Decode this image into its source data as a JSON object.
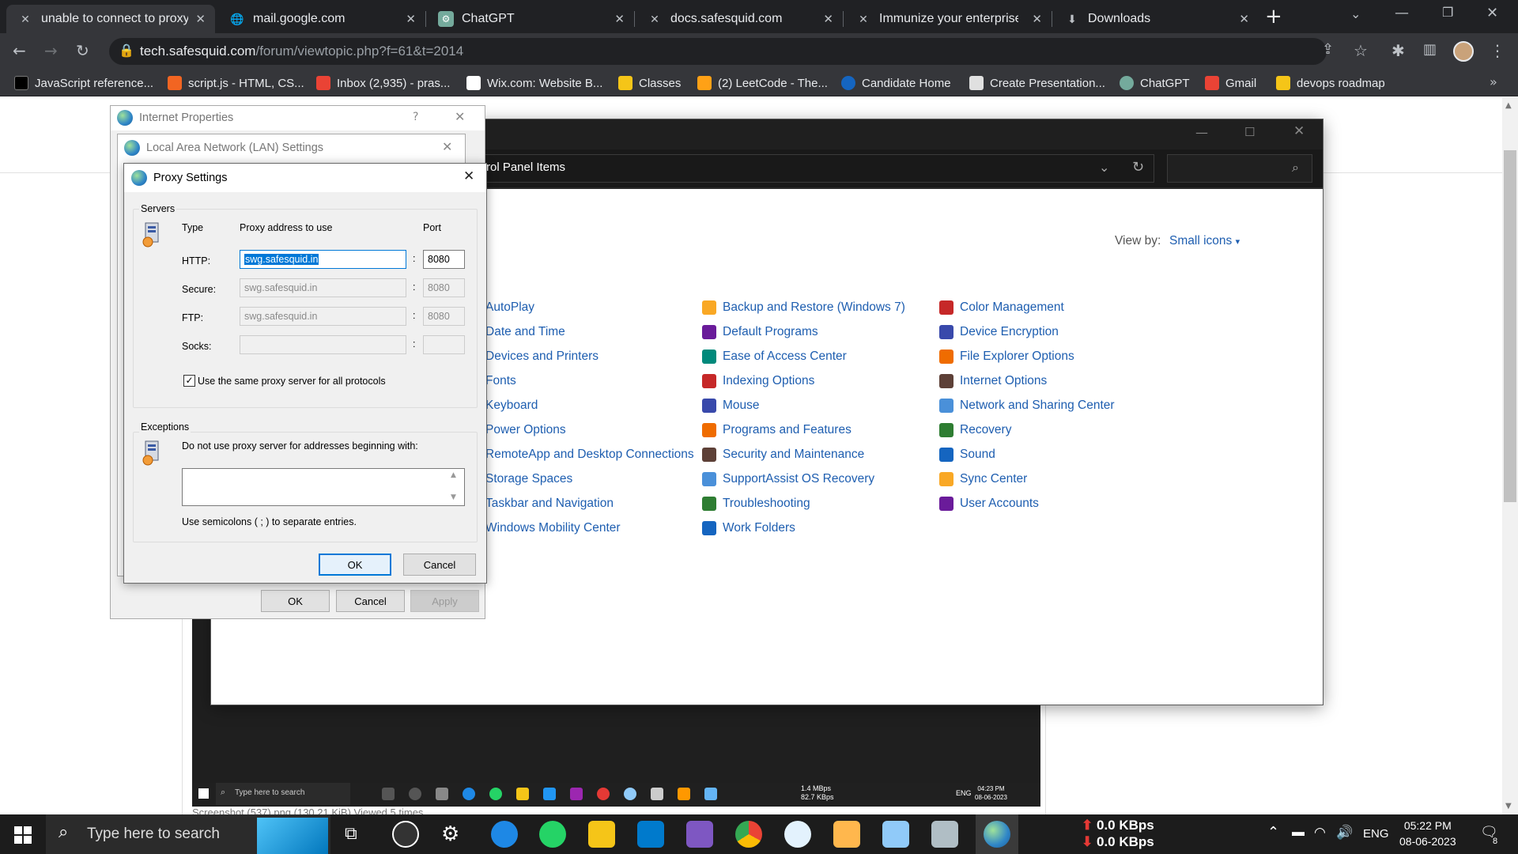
{
  "browser": {
    "tabs": [
      {
        "title": "unable to connect to proxy",
        "icon": "tools-icon"
      },
      {
        "title": "mail.google.com",
        "icon": "globe-icon"
      },
      {
        "title": "ChatGPT",
        "icon": "chatgpt-icon"
      },
      {
        "title": "docs.safesquid.com",
        "icon": "tools-icon"
      },
      {
        "title": "Immunize your enterprise",
        "icon": "tools-icon"
      },
      {
        "title": "Downloads",
        "icon": "download-icon"
      }
    ],
    "url_host": "tech.safesquid.com",
    "url_path": "/forum/viewtopic.php?f=61&t=2014",
    "bookmarks": [
      {
        "label": "JavaScript reference...",
        "color": "#000000"
      },
      {
        "label": "script.js - HTML, CS...",
        "color": "#f26522"
      },
      {
        "label": "Inbox (2,935) - pras...",
        "color": "#ea4335"
      },
      {
        "label": "Wix.com: Website B...",
        "color": "#ffffff"
      },
      {
        "label": "Classes",
        "color": "#f5c518"
      },
      {
        "label": "(2) LeetCode - The...",
        "color": "#ffa116"
      },
      {
        "label": "Candidate Home",
        "color": "#1565c0"
      },
      {
        "label": "Create Presentation...",
        "color": "#e0e0e0"
      },
      {
        "label": "ChatGPT",
        "color": "#74aa9c"
      },
      {
        "label": "Gmail",
        "color": "#ea4335"
      },
      {
        "label": "devops roadmap",
        "color": "#f5c518"
      }
    ]
  },
  "control_panel": {
    "address": "rol Panel Items",
    "view_by_label": "View by:",
    "view_by_value": "Small icons",
    "items_col1": [
      "AutoPlay",
      "Date and Time",
      "Devices and Printers",
      "Fonts",
      "Keyboard",
      "Power Options",
      "RemoteApp and Desktop Connections",
      "Storage Spaces",
      "Taskbar and Navigation",
      "Windows Mobility Center"
    ],
    "items_col2": [
      "Backup and Restore (Windows 7)",
      "Default Programs",
      "Ease of Access Center",
      "Indexing Options",
      "Mouse",
      "Programs and Features",
      "Security and Maintenance",
      "SupportAssist OS Recovery",
      "Troubleshooting",
      "Work Folders"
    ],
    "items_col3": [
      "Color Management",
      "Device Encryption",
      "File Explorer Options",
      "Internet Options",
      "Network and Sharing Center",
      "Recovery",
      "Sound",
      "Sync Center",
      "User Accounts"
    ]
  },
  "internet_properties": {
    "title": "Internet Properties",
    "help": "?",
    "ok": "OK",
    "cancel": "Cancel",
    "apply": "Apply"
  },
  "lan_settings": {
    "title": "Local Area Network (LAN) Settings"
  },
  "proxy_settings": {
    "title": "Proxy Settings",
    "servers_label": "Servers",
    "col_type": "Type",
    "col_address": "Proxy address to use",
    "col_port": "Port",
    "rows": [
      {
        "type": "HTTP:",
        "address": "swg.safesquid.in",
        "port": "8080"
      },
      {
        "type": "Secure:",
        "address": "swg.safesquid.in",
        "port": "8080"
      },
      {
        "type": "FTP:",
        "address": "swg.safesquid.in",
        "port": "8080"
      },
      {
        "type": "Socks:",
        "address": "",
        "port": ""
      }
    ],
    "colon": ":",
    "same_proxy_label": "Use the same proxy server for all protocols",
    "exceptions_label": "Exceptions",
    "exceptions_desc": "Do not use proxy server for addresses beginning with:",
    "exceptions_value": "",
    "exceptions_hint": "Use semicolons ( ; ) to separate entries.",
    "ok": "OK",
    "cancel": "Cancel"
  },
  "embedded_shot": {
    "search": "Type here to search",
    "net_up": "1.4 MBps",
    "net_down": "82.7 KBps",
    "lang": "ENG",
    "time": "04:23 PM",
    "date": "08-06-2023",
    "caption": "Screenshot (537).png (130.21 KiB) Viewed 5 times"
  },
  "taskbar": {
    "search_placeholder": "Type here to search",
    "net_up": "0.0 KBps",
    "net_down": "0.0 KBps",
    "lang": "ENG",
    "time": "05:22 PM",
    "date": "08-06-2023",
    "notif_count": "8"
  }
}
